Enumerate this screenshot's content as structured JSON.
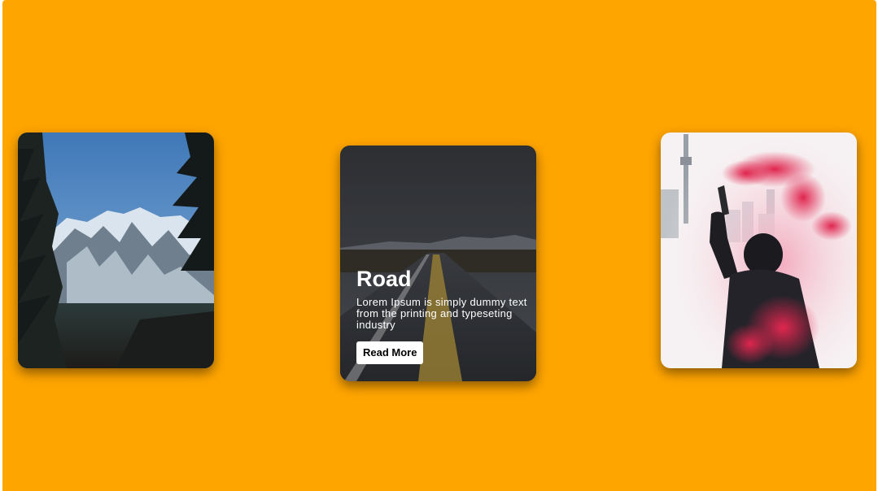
{
  "page": {
    "background_color": "#FFA500"
  },
  "cards": [
    {
      "id": "mountain",
      "image": "snowy-mountain-with-pine-trees"
    },
    {
      "id": "road",
      "image": "long-road-under-cloudy-sky",
      "title": "Road",
      "description": "Lorem Ipsum is simply dummy text from the printing and typeseting industry",
      "button_label": "Read More"
    },
    {
      "id": "smoke",
      "image": "person-holding-red-smoke-flare-city-skyline"
    }
  ]
}
